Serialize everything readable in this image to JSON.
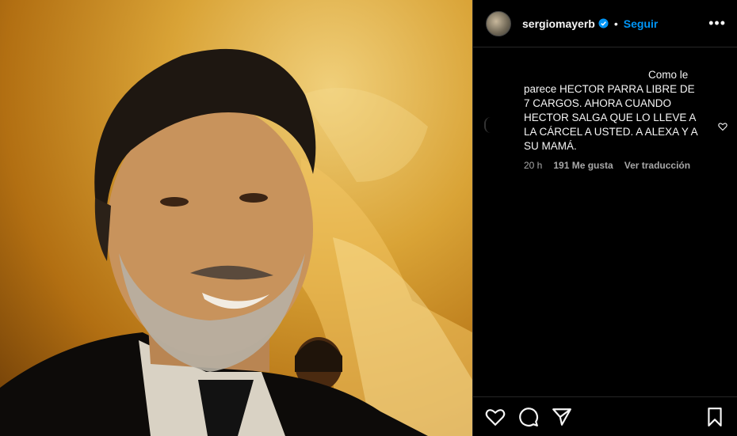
{
  "post": {
    "username": "sergiomayerb",
    "separator": "•",
    "follow_label": "Seguir",
    "more_label": "•••"
  },
  "comment": {
    "text_first": "Como le",
    "text_rest": "parece HECTOR PARRA LIBRE DE 7 CARGOS. AHORA CUANDO HECTOR SALGA QUE LO LLEVE A LA CÁRCEL A USTED. A ALEXA Y A SU MAMÁ.",
    "time": "20 h",
    "likes": "191 Me gusta",
    "translate": "Ver traducción"
  },
  "icons": {
    "verified": "verified-badge-icon",
    "like": "heart-icon",
    "comment": "comment-icon",
    "share": "send-icon",
    "save": "bookmark-icon",
    "options": "more-options-icon"
  },
  "colors": {
    "accent": "#0095f6",
    "background": "#000000",
    "text": "#f5f5f5",
    "muted": "#a8a8a8"
  }
}
